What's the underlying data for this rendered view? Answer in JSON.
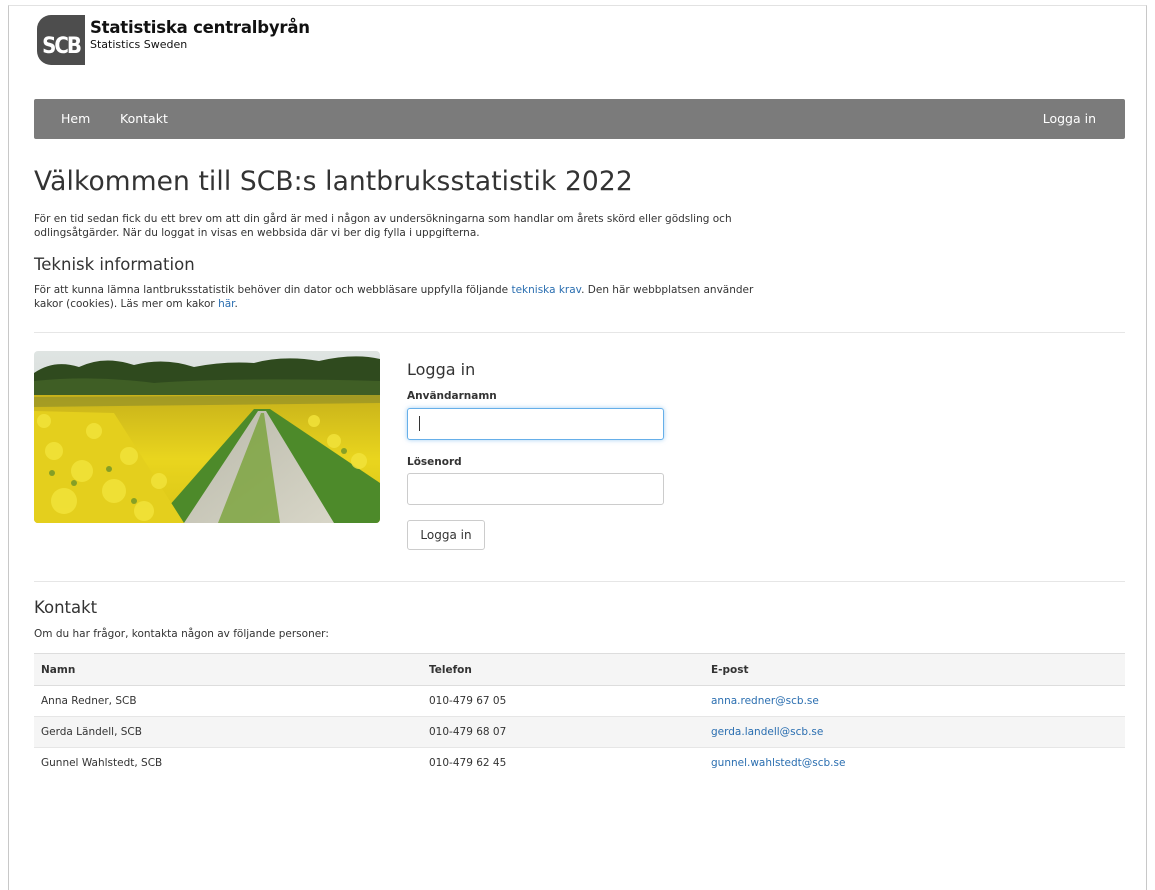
{
  "brand": {
    "name": "Statistiska centralbyrån",
    "subtitle": "Statistics Sweden",
    "logo_text": "SCB"
  },
  "nav": {
    "items": [
      {
        "label": "Hem"
      },
      {
        "label": "Kontakt"
      }
    ],
    "login_label": "Logga in"
  },
  "page": {
    "title": "Välkommen till SCB:s lantbruksstatistik 2022",
    "intro": "För en tid sedan fick du ett brev om att din gård är med i någon av undersökningarna som handlar om årets skörd eller gödsling och odlingsåtgärder. När du loggat in visas en webbsida där vi ber dig fylla i uppgifterna.",
    "tech_title": "Teknisk information",
    "tech_text_1": "För att kunna lämna lantbruksstatistik behöver din dator och webbläsare uppfylla följande ",
    "tech_link_1": "tekniska krav",
    "tech_text_2": ". Den här webbplatsen använder kakor (cookies). Läs mer om kakor ",
    "tech_link_2": "här",
    "tech_text_3": "."
  },
  "login": {
    "title": "Logga in",
    "username_label": "Användarnamn",
    "username_value": "",
    "password_label": "Lösenord",
    "password_value": "",
    "button_label": "Logga in"
  },
  "contact": {
    "title": "Kontakt",
    "intro": "Om du har frågor, kontakta någon av följande personer:",
    "headers": [
      "Namn",
      "Telefon",
      "E-post"
    ],
    "rows": [
      {
        "name": "Anna Redner, SCB",
        "phone": "010-479 67 05",
        "email": "anna.redner@scb.se"
      },
      {
        "name": "Gerda Ländell, SCB",
        "phone": "010-479 68 07",
        "email": "gerda.landell@scb.se"
      },
      {
        "name": "Gunnel Wahlstedt, SCB",
        "phone": "010-479 62 45",
        "email": "gunnel.wahlstedt@scb.se"
      }
    ]
  },
  "colors": {
    "navbar": "#7b7b7b",
    "link": "#2a6eb0",
    "text": "#333333",
    "rapeseed": "#e8d21c"
  },
  "image": {
    "icon": "rapeseed-field-image"
  }
}
